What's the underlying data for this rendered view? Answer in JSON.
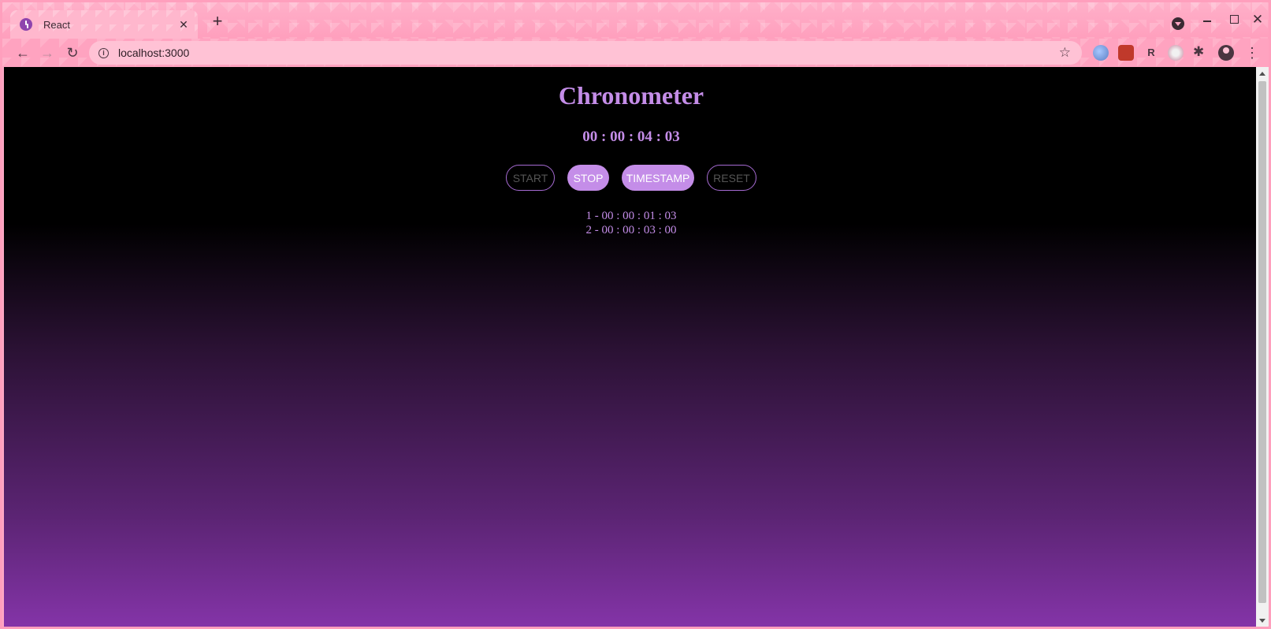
{
  "browser": {
    "tab_title": "React",
    "tab_close": "✕",
    "new_tab": "+",
    "url": "localhost:3000",
    "info_icon": "i",
    "star_icon": "☆",
    "back_icon": "←",
    "forward_icon": "→",
    "reload_icon": "↻",
    "close_window": "✕",
    "extension_label": "R",
    "puzzle_icon": "✱",
    "menu_icon": "⋮"
  },
  "app": {
    "title": "Chronometer",
    "timer": "00 : 00 : 04 : 03",
    "buttons": {
      "start": "START",
      "stop": "STOP",
      "timestamp": "TIMESTAMP",
      "reset": "RESET"
    },
    "laps": [
      "1 - 00 : 00 : 01 : 03",
      "2 - 00 : 00 : 03 : 00"
    ]
  },
  "colors": {
    "accent": "#c48de8",
    "background_top": "#000000",
    "background_bottom": "#8434a8",
    "browser_theme": "#ffa8c5"
  }
}
